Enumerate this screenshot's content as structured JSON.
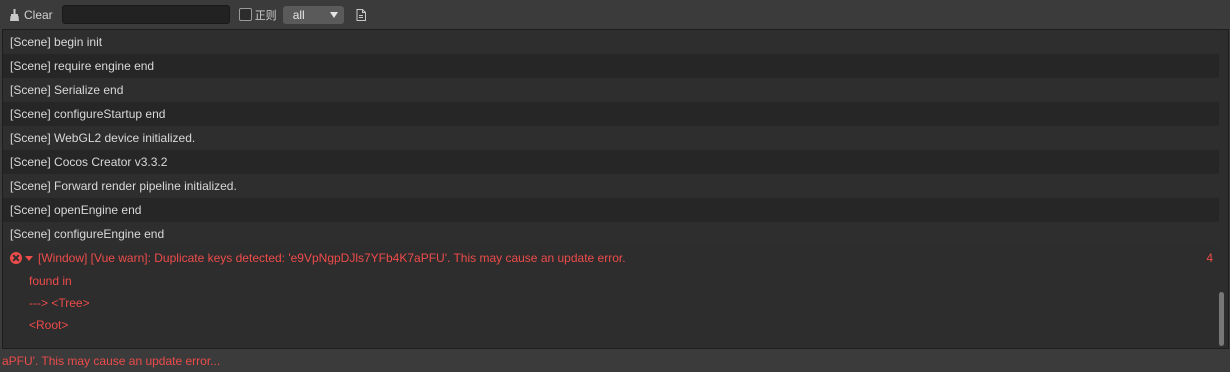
{
  "toolbar": {
    "clear_label": "Clear",
    "search_value": "",
    "regex_label": "正则",
    "regex_checked": false,
    "level_select": "all"
  },
  "logs": [
    "[Scene] begin init",
    "[Scene] require engine end",
    "[Scene] Serialize end",
    "[Scene] configureStartup end",
    "[Scene] WebGL2 device initialized.",
    "[Scene] Cocos Creator v3.3.2",
    "[Scene] Forward render pipeline initialized.",
    "[Scene] openEngine end",
    "[Scene] configureEngine end"
  ],
  "error": {
    "message": "[Window] [Vue warn]: Duplicate keys detected: 'e9VpNgpDJls7YFb4K7aPFU'. This may cause an update error.",
    "count": "4",
    "details": [
      "found in",
      "---> <Tree>",
      "<Root>"
    ]
  },
  "status_text": "aPFU'. This may cause an update error...",
  "colors": {
    "error": "#ee4b4b",
    "background": "#2d2d2d",
    "toolbar": "#3b3b3b"
  }
}
